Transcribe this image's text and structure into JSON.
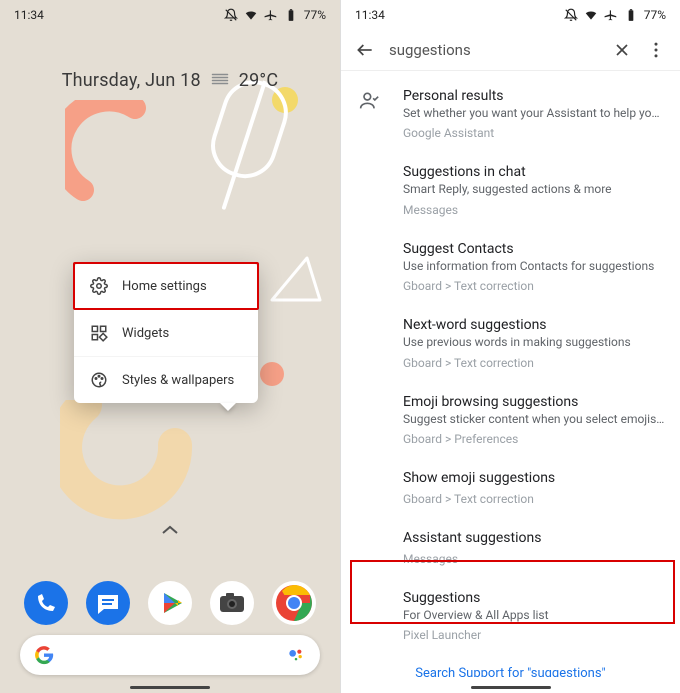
{
  "status": {
    "time": "11:34",
    "battery": "77%"
  },
  "left": {
    "date": "Thursday, Jun 18",
    "temp": "29°C",
    "menu": [
      {
        "label": "Home settings"
      },
      {
        "label": "Widgets"
      },
      {
        "label": "Styles & wallpapers"
      }
    ]
  },
  "right": {
    "query": "suggestions",
    "results": [
      {
        "title": "Personal results",
        "sub": "Set whether you want your Assistant to help you with y..",
        "path": "Google Assistant"
      },
      {
        "title": "Suggestions in chat",
        "sub": "Smart Reply, suggested actions & more",
        "path": "Messages"
      },
      {
        "title": "Suggest Contacts",
        "sub": "Use information from Contacts for suggestions",
        "path": "Gboard > Text correction"
      },
      {
        "title": "Next-word suggestions",
        "sub": "Use previous words in making suggestions",
        "path": "Gboard > Text correction"
      },
      {
        "title": "Emoji browsing suggestions",
        "sub": "Suggest sticker content when you select emojis in the..",
        "path": "Gboard > Preferences"
      },
      {
        "title": "Show emoji suggestions",
        "sub": "",
        "path": "Gboard > Text correction"
      },
      {
        "title": "Assistant suggestions",
        "sub": "",
        "path": "Messages"
      },
      {
        "title": "Suggestions",
        "sub": "For Overview & All Apps list",
        "path": "Pixel Launcher"
      }
    ],
    "support": "Search Support for \"suggestions\""
  }
}
